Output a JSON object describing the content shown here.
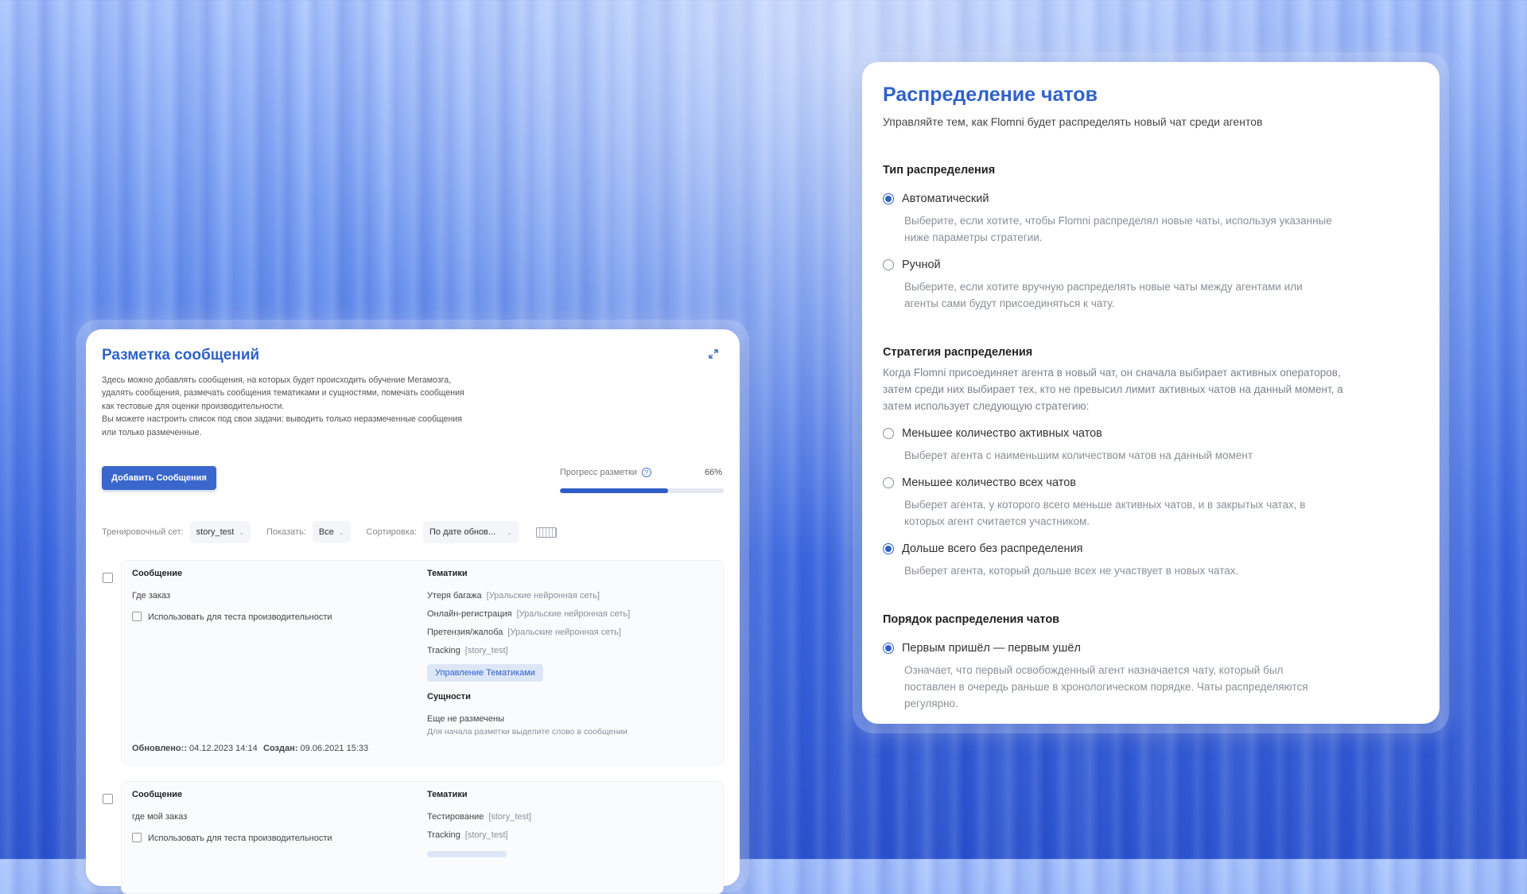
{
  "distribution": {
    "title": "Распределение чатов",
    "subtitle": "Управляйте тем, как Flomni будет распределять новый чат среди агентов",
    "type_section": "Тип распределения",
    "type_options": [
      {
        "label": "Автоматический",
        "selected": true,
        "desc": "Выберите, если хотите, чтобы Flomni распределял новые чаты, используя указанные ниже параметры стратегии."
      },
      {
        "label": "Ручной",
        "selected": false,
        "desc": "Выберите, если хотите вручную распределять новые чаты между агентами или агенты сами будут присоединяться к чату."
      }
    ],
    "strategy_section": "Стратегия распределения",
    "strategy_intro": "Когда Flomni присоединяет агента в новый чат, он сначала выбирает активных операторов, затем среди них выбирает тех, кто не превысил лимит активных чатов на данный момент, а затем использует следующую стратегию:",
    "strategy_options": [
      {
        "label": "Меньшее количество активных чатов",
        "selected": false,
        "desc": "Выберет агента с наименьшим количеством чатов на данный момент"
      },
      {
        "label": "Меньшее количество всех чатов",
        "selected": false,
        "desc": "Выберет агента, у которого всего меньше активных чатов, и в закрытых чатах, в которых агент считается участником."
      },
      {
        "label": "Дольше всего без распределения",
        "selected": true,
        "desc": "Выберет агента, который дольше всех не участвует в новых чатах."
      }
    ],
    "order_section": "Порядок распределения чатов",
    "order_options": [
      {
        "label": "Первым пришёл — первым ушёл",
        "selected": true,
        "desc": "Означает, что первый освобожденный агент назначается чату, который был поставлен в очередь раньше в хронологическом порядке. Чаты распределяются регулярно."
      }
    ]
  },
  "markup": {
    "title": "Разметка сообщений",
    "intro": [
      "Здесь можно добавлять сообщения, на которых будет происходить обучение Мегамозга,",
      "удалять сообщения, размечать сообщения тематиками и сущностями, помечать сообщения",
      "как тестовые для оценки производительности.",
      "Вы можете настроить список под свои задачи: выводить только неразмеченные сообщения",
      "или только размеченные."
    ],
    "add_button": "Добавить Сообщения",
    "progress_label": "Прогресс разметки",
    "progress_value": "66%",
    "progress_fraction": 0.66,
    "filters": {
      "set_label": "Тренировочный сет:",
      "set_value": "story_test",
      "show_label": "Показать:",
      "show_value": "Все",
      "sort_label": "Сортировка:",
      "sort_value": "По дате обнов..."
    },
    "messages": [
      {
        "message_header": "Сообщение",
        "text": "Где заказ",
        "perf_label": "Использовать для теста производительности",
        "topics_header": "Тематики",
        "topics": [
          {
            "name": "Утеря багажа",
            "tag": "[Уральские нейронная сеть]"
          },
          {
            "name": "Онлайн-регистрация",
            "tag": "[Уральские нейронная сеть]"
          },
          {
            "name": "Претензия/жалоба",
            "tag": "[Уральские нейронная сеть]"
          },
          {
            "name": "Tracking",
            "tag": "[story_test]"
          }
        ],
        "manage_button": "Управление Тематиками",
        "entities_header": "Сущности",
        "entities_empty": "Еще не размечены",
        "entities_hint": "Для начала разметки выделите слово в сообщении",
        "updated_label": "Обновлено::",
        "updated_value": "04.12.2023 14:14",
        "created_label": "Создан:",
        "created_value": "09.06.2021 15:33"
      },
      {
        "message_header": "Сообщение",
        "text": "где мой заказ",
        "perf_label": "Использовать для теста производительности",
        "topics_header": "Тематики",
        "topics": [
          {
            "name": "Тестирование",
            "tag": "[story_test]"
          },
          {
            "name": "Tracking",
            "tag": "[story_test]"
          }
        ]
      }
    ]
  }
}
